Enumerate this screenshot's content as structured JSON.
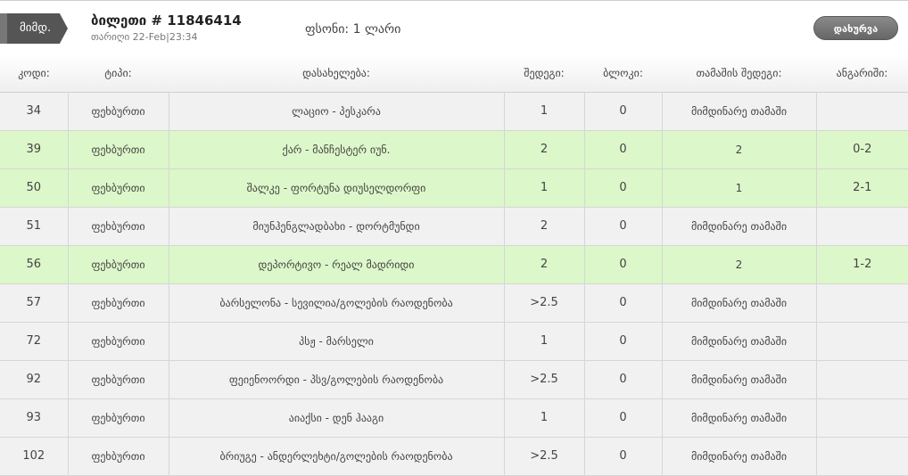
{
  "header": {
    "badge": "მიმდ.",
    "title": "ბილეთი # 11846414",
    "date": "თარიღი 22-Feb|23:34",
    "price": "ფსონი: 1 ლარი",
    "close_label": "დახურვა"
  },
  "table": {
    "columns": [
      "კოდი:",
      "ტიპი:",
      "დასახელება:",
      "შედეგი:",
      "ბლოკი:",
      "თამაშის შედეგი:",
      "ანგარიში:"
    ],
    "rows": [
      {
        "code": "34",
        "type": "ფეხბურთი",
        "name": "ლაციო - პესკარა",
        "result": "1",
        "block": "0",
        "game_result": "მიმდინარე თამაში",
        "score": "",
        "status": "grey"
      },
      {
        "code": "39",
        "type": "ფეხბურთი",
        "name": "ქარ - მანჩესტერ იუნ.",
        "result": "2",
        "block": "0",
        "game_result": "2",
        "score": "0-2",
        "status": "green"
      },
      {
        "code": "50",
        "type": "ფეხბურთი",
        "name": "შალკე - ფორტუნა დიუსელდორფი",
        "result": "1",
        "block": "0",
        "game_result": "1",
        "score": "2-1",
        "status": "green"
      },
      {
        "code": "51",
        "type": "ფეხბურთი",
        "name": "მიუნჰენგლადბახი - დორტმუნდი",
        "result": "2",
        "block": "0",
        "game_result": "მიმდინარე თამაში",
        "score": "",
        "status": "grey"
      },
      {
        "code": "56",
        "type": "ფეხბურთი",
        "name": "დეპორტივო - რეალ მადრიდი",
        "result": "2",
        "block": "0",
        "game_result": "2",
        "score": "1-2",
        "status": "green"
      },
      {
        "code": "57",
        "type": "ფეხბურთი",
        "name": "ბარსელონა - სევილია/გოლების რაოდენობა",
        "result": ">2.5",
        "block": "0",
        "game_result": "მიმდინარე თამაში",
        "score": "",
        "status": "grey"
      },
      {
        "code": "72",
        "type": "ფეხბურთი",
        "name": "პსჟ - მარსელი",
        "result": "1",
        "block": "0",
        "game_result": "მიმდინარე თამაში",
        "score": "",
        "status": "grey"
      },
      {
        "code": "92",
        "type": "ფეხბურთი",
        "name": "ფეიენოორდი - პსვ/გოლების რაოდენობა",
        "result": ">2.5",
        "block": "0",
        "game_result": "მიმდინარე თამაში",
        "score": "",
        "status": "grey"
      },
      {
        "code": "93",
        "type": "ფეხბურთი",
        "name": "აიაქსი - დენ ჰააგი",
        "result": "1",
        "block": "0",
        "game_result": "მიმდინარე თამაში",
        "score": "",
        "status": "grey"
      },
      {
        "code": "102",
        "type": "ფეხბურთი",
        "name": "ბრიუგე - ანდერლეხტი/გოლების რაოდენობა",
        "result": ">2.5",
        "block": "0",
        "game_result": "მიმდინარე თამაში",
        "score": "",
        "status": "grey"
      }
    ]
  }
}
